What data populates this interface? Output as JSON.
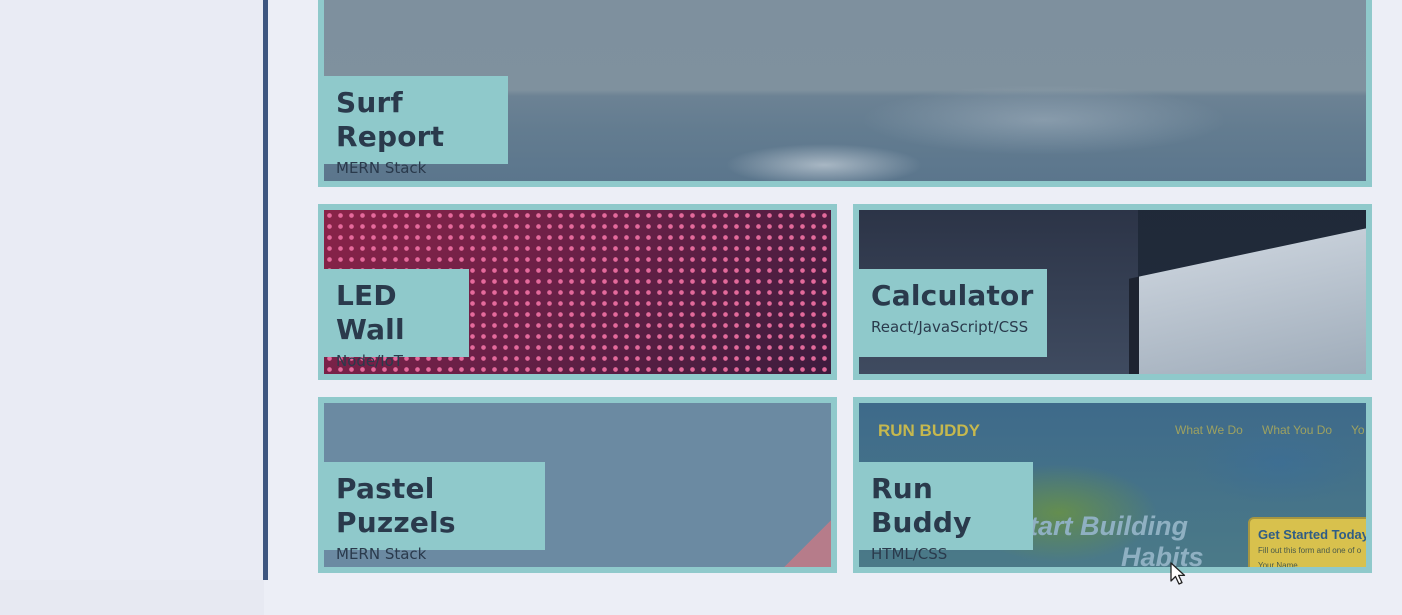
{
  "background_color": "#eceef6",
  "accent_color": "#8fc9cb",
  "divider_color": "#3e5680",
  "projects": [
    {
      "title": "Surf Report",
      "subtitle": "MERN Stack"
    },
    {
      "title": "LED Wall",
      "subtitle": "Node/IoT"
    },
    {
      "title": "Calculator",
      "subtitle": "React/JavaScript/CSS"
    },
    {
      "title": "Pastel Puzzels",
      "subtitle": "MERN Stack"
    },
    {
      "title": "Run Buddy",
      "subtitle": "HTML/CSS",
      "preview": {
        "brand": "RUN BUDDY",
        "nav": [
          "What We Do",
          "What You Do",
          "Yo"
        ],
        "hero": "tart Building",
        "hero_line2": "Habits",
        "form_title": "Get Started Today",
        "form_text": "Fill out this form and one of o",
        "form_field": "Your Name"
      }
    }
  ],
  "cursor_icon": "mouse-pointer-icon"
}
